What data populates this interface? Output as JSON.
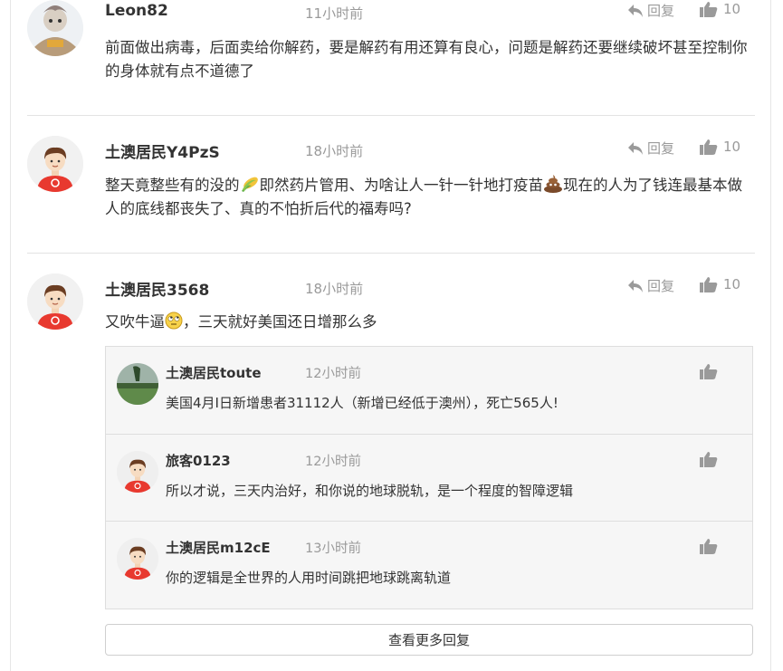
{
  "comments": [
    {
      "user": "Leon82",
      "time": "11小时前",
      "reply_label": "回复",
      "likes": "10",
      "text": "前面做出病毒，后面卖给你解药，要是解药有用还算有良心，问题是解药还要继续破坏甚至控制你的身体就有点不道德了"
    },
    {
      "user": "土澳居民Y4PzS",
      "time": "18小时前",
      "reply_label": "回复",
      "likes": "10",
      "text_a": "整天竟整些有的没的",
      "text_b": "即然药片管用、为啥让人一针一针地打疫苗",
      "text_c": "现在的人为了钱连最基本做人的底线都丧失了、真的不怕折后代的福寿吗?"
    },
    {
      "user": "土澳居民3568",
      "time": "18小时前",
      "reply_label": "回复",
      "likes": "10",
      "text_a": "又吹牛逼",
      "text_b": "，三天就好美国还日增那么多",
      "replies": [
        {
          "user": "土澳居民toute",
          "time": "12小时前",
          "text": "美国4月I日新增患者31112人（新增已经低于澳州），死亡565人!"
        },
        {
          "user": "旅客0123",
          "time": "12小时前",
          "text": "所以才说，三天内治好，和你说的地球脱轨，是一个程度的智障逻辑"
        },
        {
          "user": "土澳居民m12cE",
          "time": "13小时前",
          "text": "你的逻辑是全世界的人用时间跳把地球跳离轨道"
        }
      ],
      "more_label": "查看更多回复"
    }
  ],
  "icons": {
    "reply": "reply-arrow-icon",
    "like": "thumbs-up-icon",
    "emoji_1": "corn-emoji",
    "emoji_2": "poop-emoji",
    "emoji_3": "rolling-eyes-emoji"
  },
  "colors": {
    "muted": "#9a9a9a",
    "text": "#333333",
    "reply_bg": "#f6f6f6",
    "shirt": "#e8392f"
  }
}
